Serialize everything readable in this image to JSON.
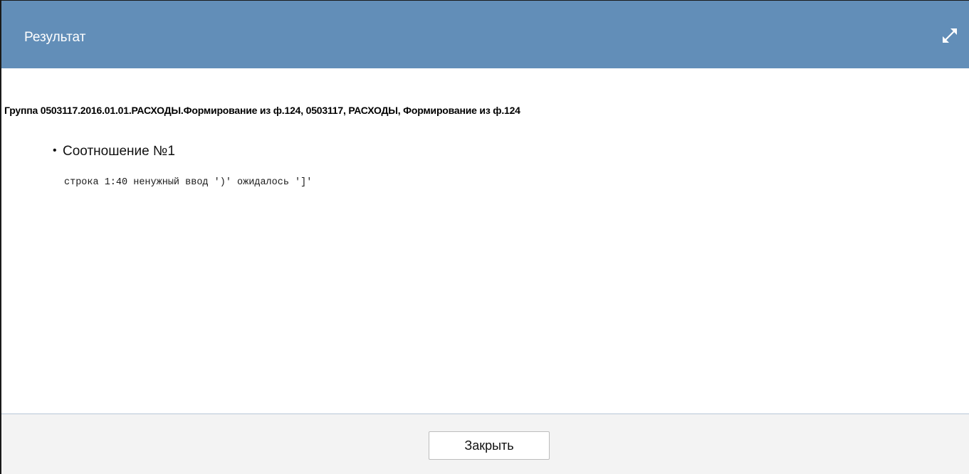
{
  "dialog": {
    "title": "Результат",
    "expand_icon": "expand-arrows-icon",
    "header_color": "#628eb8"
  },
  "content": {
    "group_title": "Группа 0503117.2016.01.01.РАСХОДЫ.Формирование из ф.124, 0503117, РАСХОДЫ, Формирование из ф.124",
    "items": [
      {
        "label": "Соотношение №1",
        "message": "строка 1:40 ненужный ввод ')' ожидалось ']'"
      }
    ]
  },
  "footer": {
    "close_label": "Закрыть"
  }
}
